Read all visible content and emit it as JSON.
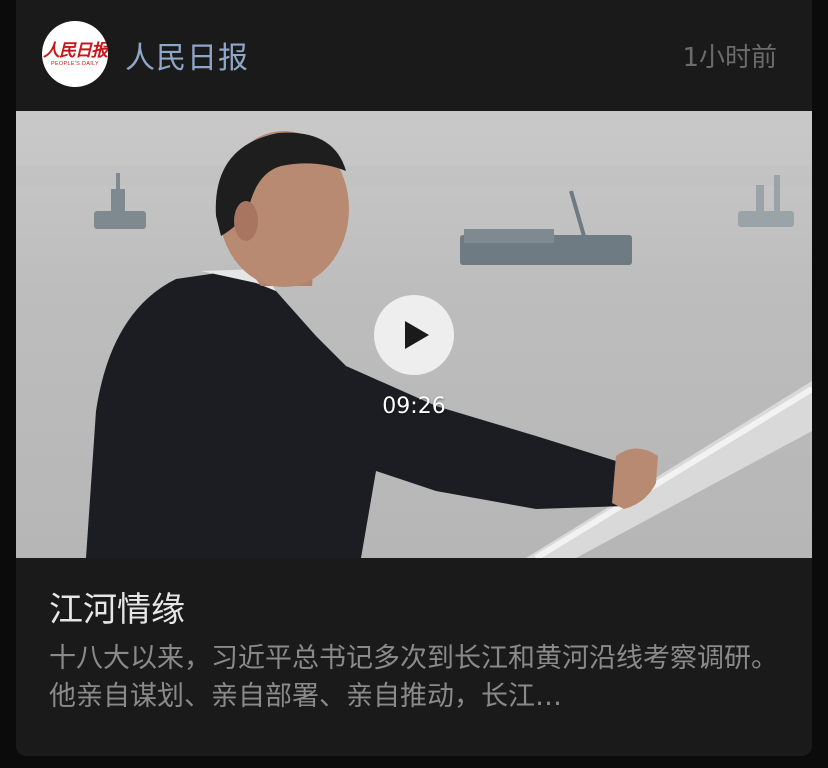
{
  "post": {
    "source_name": "人民日报",
    "logo_text_cn": "人民日报",
    "logo_text_en": "PEOPLE'S DAILY",
    "timestamp": "1小时前",
    "video": {
      "duration": "09:26",
      "play_icon": "play-icon"
    },
    "title": "江河情缘",
    "summary": "十八大以来，习近平总书记多次到长江和黄河沿线考察调研。他亲自谋划、亲自部署、亲自推动，长江…"
  },
  "colors": {
    "background": "#0b0b0b",
    "card": "#1a1a1a",
    "source_name": "#8ea6c8",
    "timestamp": "#6b6b6b",
    "title": "#e6e6e6",
    "summary": "#8a8a8a",
    "logo_red": "#c8161d"
  }
}
